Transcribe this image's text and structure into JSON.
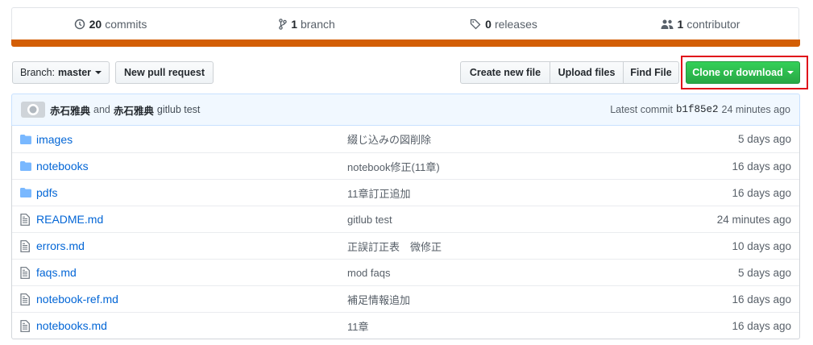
{
  "summary": {
    "commits": {
      "count": "20",
      "label": "commits",
      "icon": "history-icon"
    },
    "branches": {
      "count": "1",
      "label": "branch",
      "icon": "git-branch-icon"
    },
    "releases": {
      "count": "0",
      "label": "releases",
      "icon": "tag-icon"
    },
    "contributors": {
      "count": "1",
      "label": "contributor",
      "icon": "people-icon"
    }
  },
  "language_color": "#d35e05",
  "toolbar": {
    "branch_prefix": "Branch:",
    "branch_name": "master",
    "new_pr": "New pull request",
    "create_file": "Create new file",
    "upload_files": "Upload files",
    "find_file": "Find File",
    "clone_download": "Clone or download"
  },
  "commit": {
    "author": "赤石雅典",
    "and": "and",
    "committer": "赤石雅典",
    "message": "gitlub test",
    "latest_label": "Latest commit",
    "sha": "b1f85e2",
    "time": "24 minutes ago"
  },
  "files": [
    {
      "name": "images",
      "type": "folder",
      "message": "綴じ込みの図削除",
      "age": "5 days ago"
    },
    {
      "name": "notebooks",
      "type": "folder",
      "message": "notebook修正(11章)",
      "age": "16 days ago"
    },
    {
      "name": "pdfs",
      "type": "folder",
      "message": "11章訂正追加",
      "age": "16 days ago"
    },
    {
      "name": "README.md",
      "type": "file",
      "message": "gitlub test",
      "age": "24 minutes ago"
    },
    {
      "name": "errors.md",
      "type": "file",
      "message": "正誤訂正表　微修正",
      "age": "10 days ago"
    },
    {
      "name": "faqs.md",
      "type": "file",
      "message": "mod faqs",
      "age": "5 days ago"
    },
    {
      "name": "notebook-ref.md",
      "type": "file",
      "message": "補足情報追加",
      "age": "16 days ago"
    },
    {
      "name": "notebooks.md",
      "type": "file",
      "message": "11章",
      "age": "16 days ago"
    }
  ],
  "colors": {
    "accent_green": "#28a745",
    "link_blue": "#0366d6",
    "folder": "#79b8ff",
    "highlight_red": "#e0101a"
  }
}
